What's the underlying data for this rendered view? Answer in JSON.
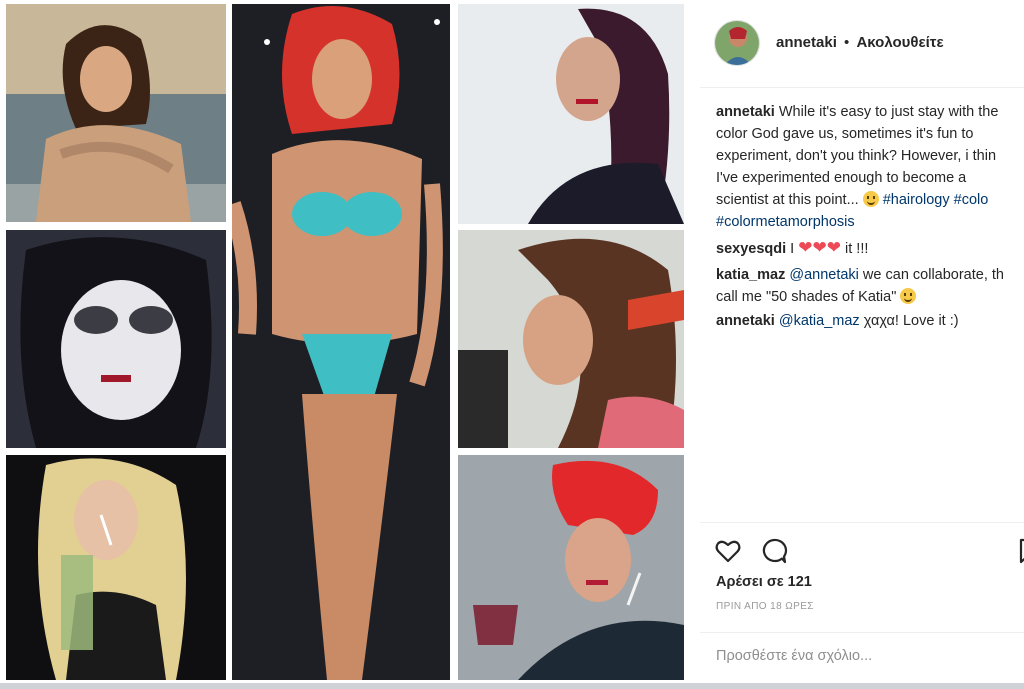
{
  "header": {
    "username": "annetaki",
    "separator": "•",
    "follow_label": "Ακολουθείτε"
  },
  "caption": {
    "user": "annetaki",
    "lines": [
      "While it's easy to just stay with the",
      "color God gave us, sometimes it's fun to",
      "experiment, don't you think? However, i thin",
      "I've experimented enough to become a",
      "scientist at this point..."
    ],
    "hashtags_line1": [
      "#hairology",
      "#colo"
    ],
    "hashtags_line2": "#colormetamorphosis"
  },
  "comments": [
    {
      "user": "sexyesqdi",
      "text_before": "I",
      "text_after": "it !!!"
    },
    {
      "user": "katia_maz",
      "mention": "@annetaki",
      "text": " we can collaborate, th",
      "line2": "call me \"50 shades of Katia\""
    },
    {
      "user": "annetaki",
      "mention": "@katia_maz",
      "text": " χαχα! Love it :)"
    }
  ],
  "actions": {
    "likes_text": "Αρέσει σε 121",
    "time_text": "ΠΡΙΝ ΑΠΟ 18 ΩΡΕΣ"
  },
  "comment_input": {
    "placeholder": "Προσθέστε ένα σχόλιο..."
  },
  "icons": {
    "like": "heart-outline-icon",
    "comment": "speech-bubble-icon",
    "save": "bookmark-icon"
  },
  "colors": {
    "text": "#262626",
    "secondary": "#8e8e8e",
    "link": "#00376b",
    "border": "#efefef"
  }
}
